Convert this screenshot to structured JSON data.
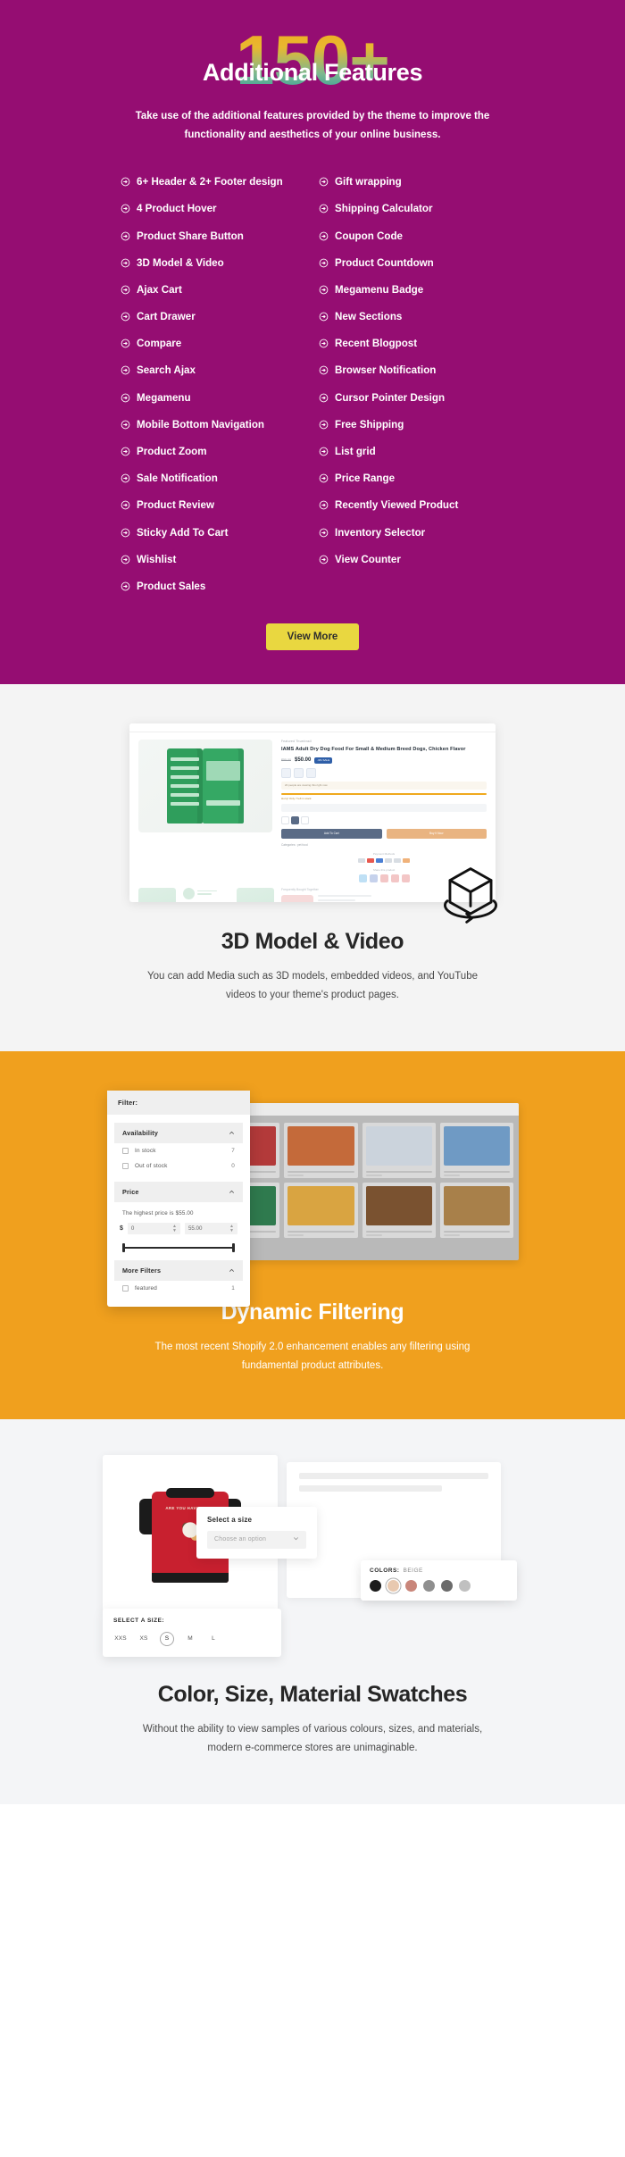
{
  "hero": {
    "number": "150",
    "plus": "+",
    "subtitle": "Additional Features",
    "description": "Take use of the additional features provided by the theme to improve the functionality and aesthetics of your online business."
  },
  "features": {
    "icon": "circle-arrow-right-icon",
    "left": [
      "6+ Header & 2+ Footer design",
      "4 Product Hover",
      "Product Share Button",
      "3D Model & Video",
      "Ajax Cart",
      "Cart Drawer",
      "Compare",
      "Search Ajax",
      "Megamenu",
      "Mobile Bottom Navigation",
      "Product Zoom",
      "Sale Notification",
      "Product Review",
      "Sticky Add To Cart",
      "Wishlist",
      "Product Sales"
    ],
    "right": [
      "Gift wrapping",
      "Shipping Calculator",
      "Coupon Code",
      "Product Countdown",
      "Megamenu Badge",
      "New Sections",
      "Recent Blogpost",
      "Browser Notification",
      "Cursor Pointer Design",
      "Free Shipping",
      "List grid",
      "Price Range",
      "Recently Viewed Product",
      "Inventory Selector",
      "View Counter"
    ],
    "view_more_label": "View More"
  },
  "section_3d": {
    "title": "3D Model & Video",
    "description": "You can add Media such as 3D models, embedded videos, and YouTube videos to your theme's product pages.",
    "cube_icon": "3d-cube-rotate-icon",
    "screenshot": {
      "vendor": "Featured Thumbnail",
      "product_title": "IAMS Adult Dry Dog Food For Small & Medium Breed Dogs, Chicken Flavor",
      "price_old": "$55.00",
      "price_new": "$50.00",
      "price_badge": "-9% SALE",
      "viewing_notice": "20 people are viewing this right now",
      "stock_notice": "Hurry! Only 7 left in stock",
      "delivery_notice": "Sold 27 product in last 15 hours",
      "qty_value": "1",
      "add_to_cart_label": "Add To Cart",
      "buy_now_label": "Buy It Now",
      "categories_line": "Categories :  pet food",
      "payment_label": "Payment Methods",
      "share_label": "Share this product",
      "fbt_label": "Frequently Bought Together"
    }
  },
  "section_filter": {
    "title": "Dynamic Filtering",
    "description": "The most recent Shopify 2.0 enhancement enables any filtering using fundamental product attributes.",
    "panel": {
      "header": "Filter:",
      "availability": {
        "label": "Availability",
        "chevron": "chevron-up-icon",
        "options": [
          {
            "label": "In stock",
            "count": "7"
          },
          {
            "label": "Out of stock",
            "count": "0"
          }
        ]
      },
      "price": {
        "label": "Price",
        "chevron": "chevron-up-icon",
        "note": "The highest price is $55.00",
        "currency": "$",
        "min_value": "0",
        "max_value": "55.00"
      },
      "more_filters": {
        "label": "More Filters",
        "chevron": "chevron-up-icon",
        "options": [
          {
            "label": "featured",
            "count": "1"
          }
        ]
      }
    }
  },
  "section_swatch": {
    "title": "Color, Size, Material Swatches",
    "description": "Without the ability to view samples of various colours, sizes, and materials, modern e-commerce stores are unimaginable.",
    "shirt_text": "ARE YOU HAVING FUN",
    "size_card": {
      "label": "Select a size",
      "placeholder": "Choose an option",
      "chevron": "chevron-down-icon"
    },
    "colors_card": {
      "label": "COLORS:",
      "value": "BEIGE",
      "swatches": [
        "#1c1c1c",
        "#e8c9b0",
        "#c9867a",
        "#8f8f8f",
        "#6b6b6b",
        "#c0c0c0"
      ]
    },
    "sizes_card": {
      "label": "SELECT A SIZE:",
      "options": [
        "XXS",
        "XS",
        "S",
        "M",
        "L"
      ],
      "selected": "S"
    }
  },
  "colors": {
    "magenta": "#950d72",
    "yellow_btn": "#e9d740",
    "orange": "#f0a01e",
    "light_grey": "#f4f4f4"
  }
}
